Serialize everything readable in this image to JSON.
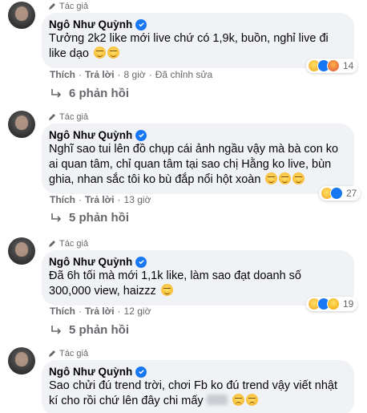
{
  "author_badge": "Tác giả",
  "author_name": "Ngô Như Quỳnh",
  "comments": [
    {
      "text": "Tưởng 2k2 like mới live chứ có 1,9k, buồn, nghỉ live đi like dạo",
      "emoji_count": 2,
      "like_label": "Thích",
      "reply_label": "Trả lời",
      "time": "8 giờ",
      "edited": "Đã chỉnh sửa",
      "reaction_count": "14",
      "replies": "6 phản hồi"
    },
    {
      "text": "Nghĩ sao tui lên đồ chụp cái ảnh ngầu vậy mà bà con ko ai quan tâm, chỉ quan tâm tại sao chị Hằng ko live, bùn ghia, nhan sắc tôi ko bù đắp nổi hột xoàn",
      "emoji_count": 3,
      "like_label": "Thích",
      "reply_label": "Trả lời",
      "time": "13 giờ",
      "reaction_count": "27",
      "replies": "5 phản hồi"
    },
    {
      "text": "Đã 6h tối mà mới 1,1k like, làm sao đạt doanh số 300,000 view, haizzz",
      "emoji_count": 1,
      "like_label": "Thích",
      "reply_label": "Trả lời",
      "time": "12 giờ",
      "reaction_count": "19",
      "replies": "5 phản hồi"
    },
    {
      "text": "Sao chửi đú trend trời, chơi Fb ko đú trend vậy viết nhật kí cho rồi chứ lên đây chi mấy",
      "emoji_count": 2
    }
  ],
  "icons": {
    "verified": "verified-badge-icon",
    "author": "pen-icon",
    "reply_arrow": "reply-arrow-icon"
  },
  "colors": {
    "bubble": "#f0f2f5",
    "verified": "#1877f2",
    "meta": "#65676b"
  }
}
